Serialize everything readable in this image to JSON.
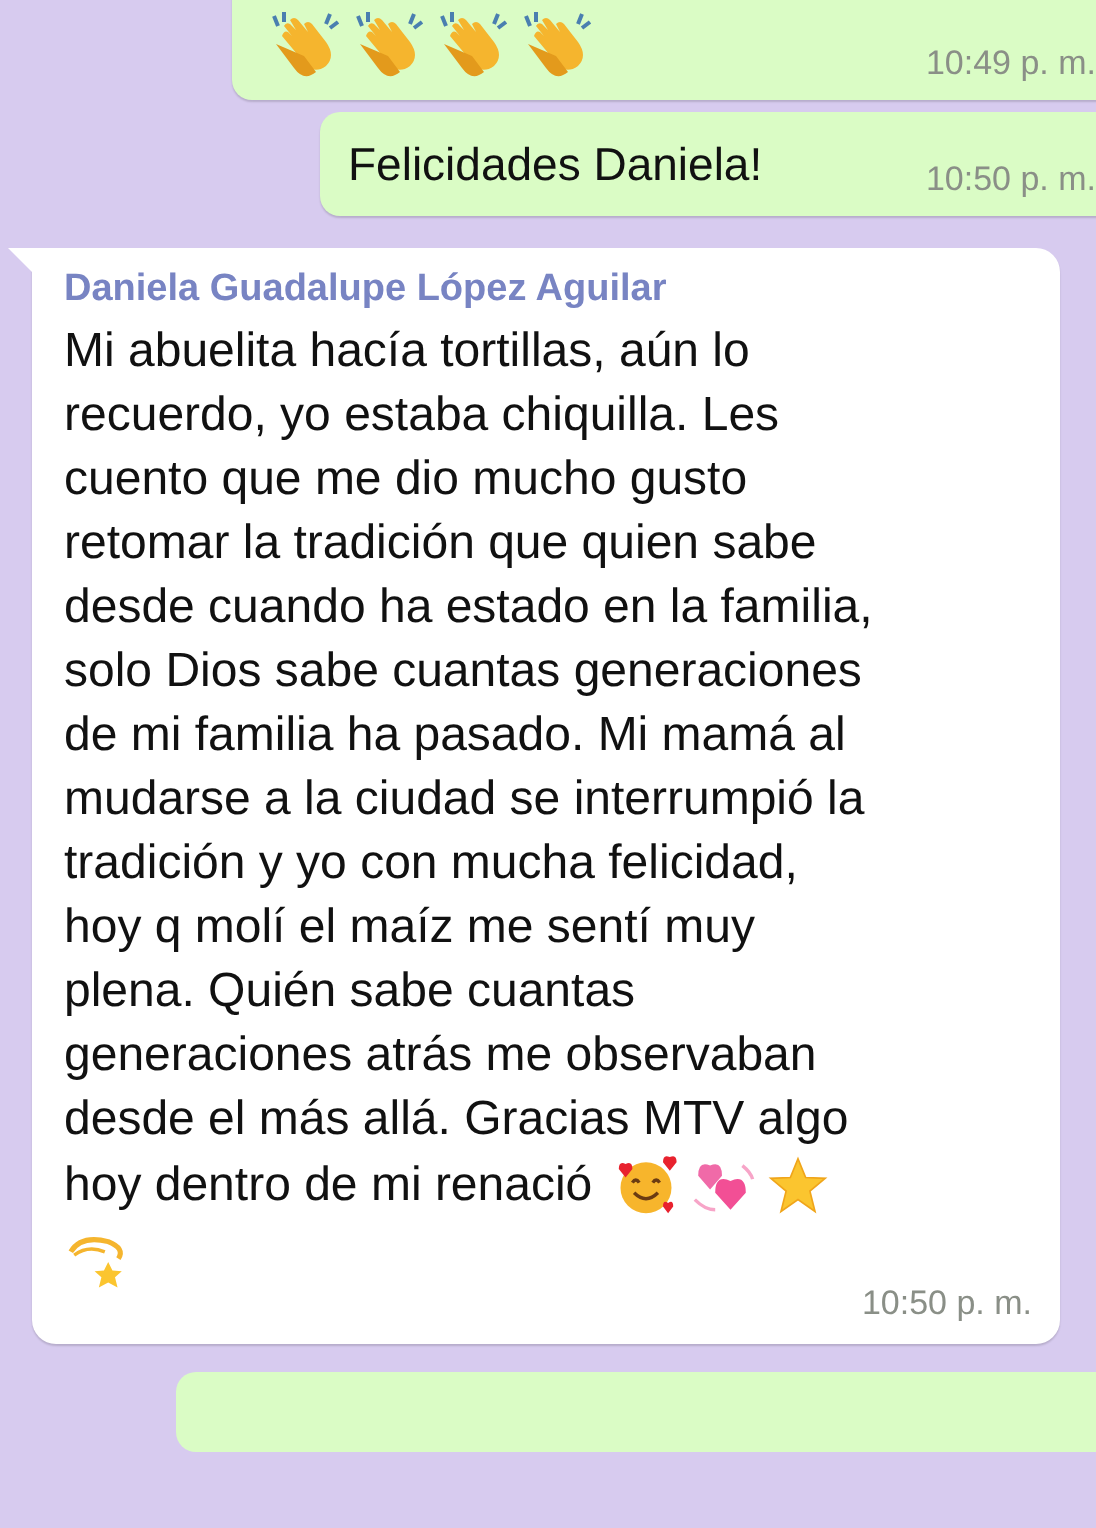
{
  "messages": [
    {
      "kind": "outgoing",
      "time": "10:49 p. m."
    },
    {
      "kind": "outgoing",
      "text": "Felicidades Daniela!",
      "time": "10:50 p. m."
    },
    {
      "kind": "incoming",
      "sender": "Daniela Guadalupe López Aguilar",
      "text": "Mi abuelita hacía tortillas, aún lo\nrecuerdo, yo estaba chiquilla. Les\ncuento que me dio mucho gusto\nretomar la tradición que quien sabe\ndesde cuando ha estado en la familia,\nsolo Dios sabe cuantas generaciones\nde mi familia ha pasado. Mi mamá al\nmudarse a la ciudad se interrumpió la\ntradición y yo con mucha felicidad,\nhoy q molí el maíz me sentí muy\nplena. Quién sabe cuantas\ngeneraciones atrás me observaban\ndesde el más allá. Gracias MTV algo",
      "text_end": "hoy dentro de mi renació",
      "time": "10:50 p. m."
    },
    {
      "kind": "outgoing-cut"
    }
  ]
}
